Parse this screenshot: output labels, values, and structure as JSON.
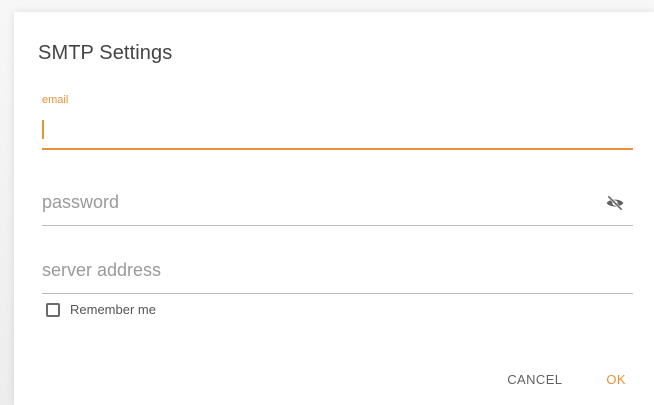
{
  "dialog": {
    "title": "SMTP Settings"
  },
  "fields": {
    "email": {
      "label": "email",
      "value": ""
    },
    "password": {
      "placeholder": "password",
      "visibility_icon": "eye-off-icon"
    },
    "server": {
      "placeholder": "server address"
    }
  },
  "remember": {
    "label": "Remember me",
    "checked": false
  },
  "actions": {
    "cancel_label": "CANCEL",
    "ok_label": "OK"
  },
  "colors": {
    "accent": "#e8913a",
    "text": "#444444",
    "muted": "#9a9a9a",
    "divider": "#bdbdbd"
  }
}
